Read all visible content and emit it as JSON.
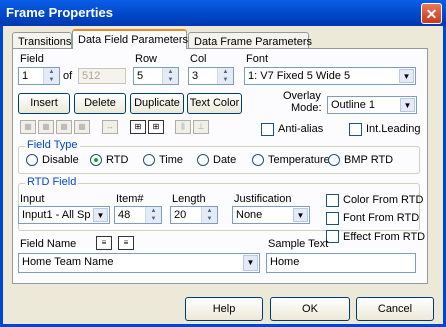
{
  "window": {
    "title": "Frame Properties",
    "close_icon": "close-icon"
  },
  "tabs": [
    "Transitions",
    "Data Field Parameters",
    "Data Frame Parameters"
  ],
  "field": {
    "label": "Field",
    "value": "1",
    "of_label": "of",
    "total": "512"
  },
  "row": {
    "label": "Row",
    "value": "5"
  },
  "col": {
    "label": "Col",
    "value": "3"
  },
  "font": {
    "label": "Font",
    "value": "1: V7 Fixed  5 Wide  5"
  },
  "buttons": {
    "insert": "Insert",
    "delete": "Delete",
    "duplicate": "Duplicate",
    "text_color": "Text Color"
  },
  "overlay": {
    "label_line1": "Overlay",
    "label_line2": "Mode:",
    "value": "Outline 1"
  },
  "checks": {
    "anti_alias": "Anti-alias",
    "int_leading": "Int.Leading"
  },
  "field_type": {
    "title": "Field Type",
    "options": [
      "Disable",
      "RTD",
      "Time",
      "Date",
      "Temperature",
      "BMP RTD"
    ],
    "selected": "RTD"
  },
  "rtd": {
    "title": "RTD Field",
    "input_label": "Input",
    "input_value": "Input1 - All Sp",
    "item_label": "Item#",
    "item_value": "48",
    "length_label": "Length",
    "length_value": "20",
    "justification_label": "Justification",
    "justification_value": "None",
    "color_from_rtd": "Color From RTD",
    "font_from_rtd": "Font From RTD",
    "effect_from_rtd": "Effect From RTD"
  },
  "field_name": {
    "label": "Field Name",
    "value": "Home Team Name"
  },
  "sample_text": {
    "label": "Sample Text",
    "value": "Home"
  },
  "footer": {
    "help": "Help",
    "ok": "OK",
    "cancel": "Cancel"
  }
}
